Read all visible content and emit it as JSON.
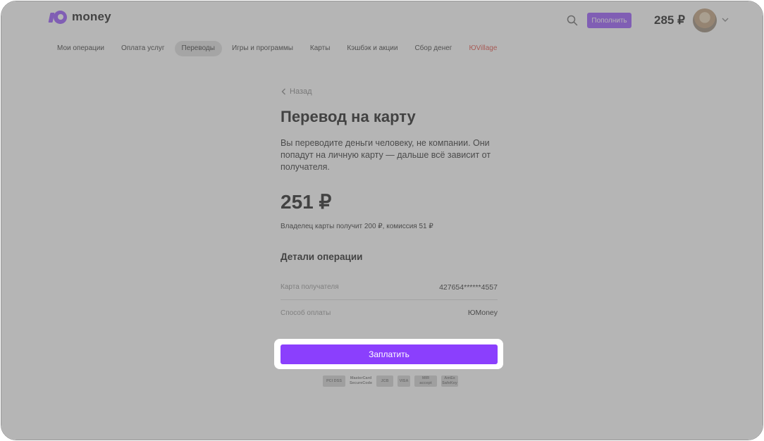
{
  "header": {
    "logo_text": "money",
    "topup_label": "Пополнить",
    "balance": "285 ₽"
  },
  "nav": {
    "items": [
      {
        "label": "Мои операции"
      },
      {
        "label": "Оплата услуг"
      },
      {
        "label": "Переводы"
      },
      {
        "label": "Игры и программы"
      },
      {
        "label": "Карты"
      },
      {
        "label": "Кэшбэк и акции"
      },
      {
        "label": "Сбор денег"
      },
      {
        "label": "ЮVillage"
      }
    ],
    "active": "Переводы"
  },
  "main": {
    "back_label": "Назад",
    "title": "Перевод на карту",
    "description": "Вы переводите деньги человеку, не компании. Они попадут на личную карту — дальше всё зависит от получателя.",
    "amount": "251 ₽",
    "amount_note": "Владелец карты получит 200 ₽, комиссия 51 ₽",
    "details_title": "Детали операции",
    "details": [
      {
        "label": "Карта получателя",
        "value": "427654******4557"
      },
      {
        "label": "Способ оплаты",
        "value": "ЮMoney"
      }
    ],
    "pay_label": "Заплатить",
    "security_logos": [
      {
        "text": "PCI DSS"
      },
      {
        "text": "MasterCard SecureCode"
      },
      {
        "text": "JCB"
      },
      {
        "text": "VISA"
      },
      {
        "text": "MIR accept"
      },
      {
        "text": "AmEx SafeKey"
      }
    ]
  },
  "colors": {
    "accent": "#8b3ffd",
    "promo": "#e0372b",
    "overlay": "#8a8a8a"
  }
}
